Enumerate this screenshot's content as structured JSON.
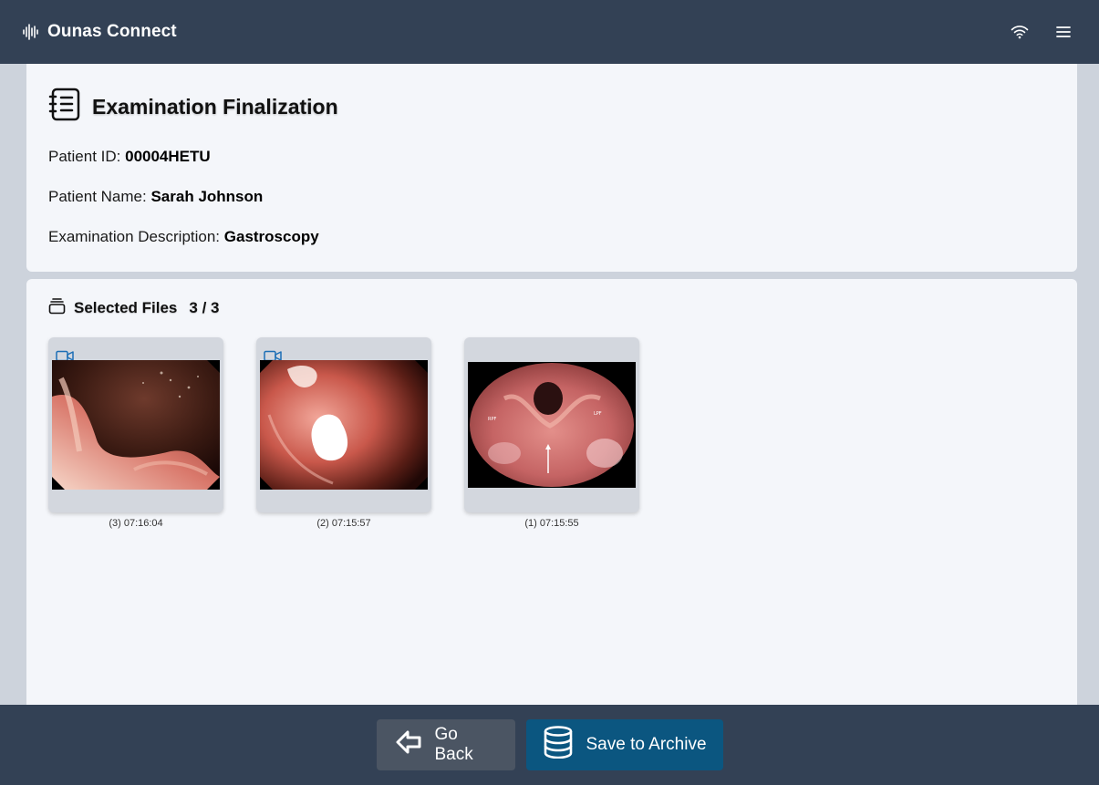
{
  "app": {
    "title": "Ounas Connect"
  },
  "icons": {
    "brand": "waveform-icon",
    "wifi": "wifi-icon",
    "menu": "hamburger-menu-icon",
    "exam": "notebook-icon",
    "files": "stack-icon",
    "video": "video-camera-icon",
    "back": "arrow-left-icon",
    "save": "database-icon"
  },
  "colors": {
    "topbar": "#334155",
    "accent": "#0b5680",
    "secondary_button": "#4b5563",
    "video_icon": "#1d6fb5"
  },
  "exam": {
    "title": "Examination Finalization",
    "patient_id_label": "Patient ID:",
    "patient_id": "00004HETU",
    "patient_name_label": "Patient Name:",
    "patient_name": "Sarah Johnson",
    "description_label": "Examination Description:",
    "description": "Gastroscopy"
  },
  "files": {
    "title": "Selected Files",
    "count": "3 / 3",
    "items": [
      {
        "caption": "(3) 07:16:04",
        "is_video": true
      },
      {
        "caption": "(2) 07:15:57",
        "is_video": true
      },
      {
        "caption": "(1) 07:15:55",
        "is_video": false
      }
    ]
  },
  "actions": {
    "back_label": "Go Back",
    "save_label": "Save to Archive"
  }
}
